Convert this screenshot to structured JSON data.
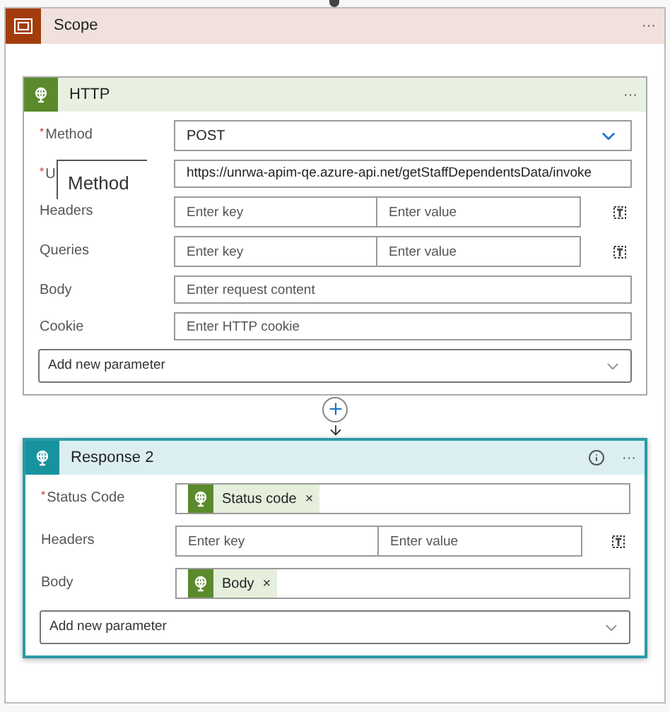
{
  "scope": {
    "title": "Scope",
    "menu": "···"
  },
  "cards": [
    {
      "kind": "http",
      "title": "HTTP",
      "menu": "···",
      "info": false,
      "selected": false,
      "fields": [
        {
          "kind": "select",
          "label": "Method",
          "required_mark": "*",
          "value": "POST"
        },
        {
          "kind": "text",
          "label": "U",
          "required_mark": "*",
          "value": "https://unrwa-apim-qe.azure-api.net/getStaffDependentsData/invoke",
          "tooltip": "Method"
        },
        {
          "kind": "keyvalue",
          "label": "Headers",
          "key_placeholder": "Enter key",
          "value_placeholder": "Enter value"
        },
        {
          "kind": "keyvalue",
          "label": "Queries",
          "key_placeholder": "Enter key",
          "value_placeholder": "Enter value"
        },
        {
          "kind": "text",
          "label": "Body",
          "placeholder": "Enter request content"
        },
        {
          "kind": "text",
          "label": "Cookie",
          "placeholder": "Enter HTTP cookie"
        }
      ],
      "add_parameter": "Add new parameter"
    },
    {
      "kind": "response",
      "title": "Response 2",
      "menu": "···",
      "info": true,
      "selected": true,
      "fields": [
        {
          "kind": "token",
          "label": "Status Code",
          "required_mark": "*",
          "token": "Status code",
          "remove": "×"
        },
        {
          "kind": "keyvalue",
          "label": "Headers",
          "key_placeholder": "Enter key",
          "value_placeholder": "Enter value"
        },
        {
          "kind": "token",
          "label": "Body",
          "token": "Body",
          "remove": "×"
        }
      ],
      "add_parameter": "Add new parameter"
    }
  ]
}
